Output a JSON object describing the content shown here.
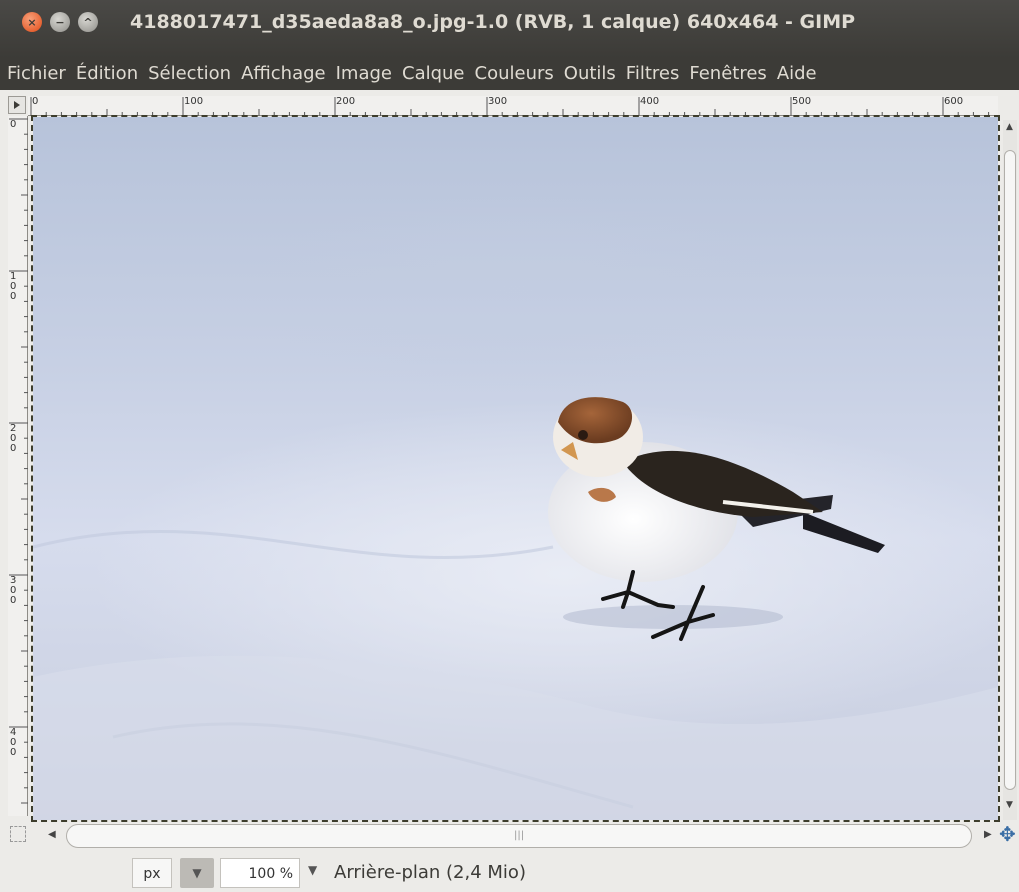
{
  "window": {
    "title": "4188017471_d35aeda8a8_o.jpg-1.0 (RVB, 1 calque) 640x464 - GIMP",
    "buttons": {
      "close": "×",
      "minimize": "−",
      "maximize": "^"
    }
  },
  "menu": [
    "Fichier",
    "Édition",
    "Sélection",
    "Affichage",
    "Image",
    "Calque",
    "Couleurs",
    "Outils",
    "Filtres",
    "Fenêtres",
    "Aide"
  ],
  "ruler": {
    "h_labels": [
      "0",
      "100",
      "200",
      "300",
      "400",
      "500",
      "600"
    ],
    "v_labels": [
      "0",
      "100",
      "200",
      "300",
      "400"
    ]
  },
  "status": {
    "unit": "px",
    "zoom": "100 %",
    "layer_info": "Arrière-plan (2,4 Mio)"
  },
  "icons": {
    "unit_dropdown": "chevron-down-icon",
    "zoom_dropdown": "chevron-down-icon",
    "navigate": "navigate-icon",
    "quick_mask": "quick-mask-icon"
  }
}
